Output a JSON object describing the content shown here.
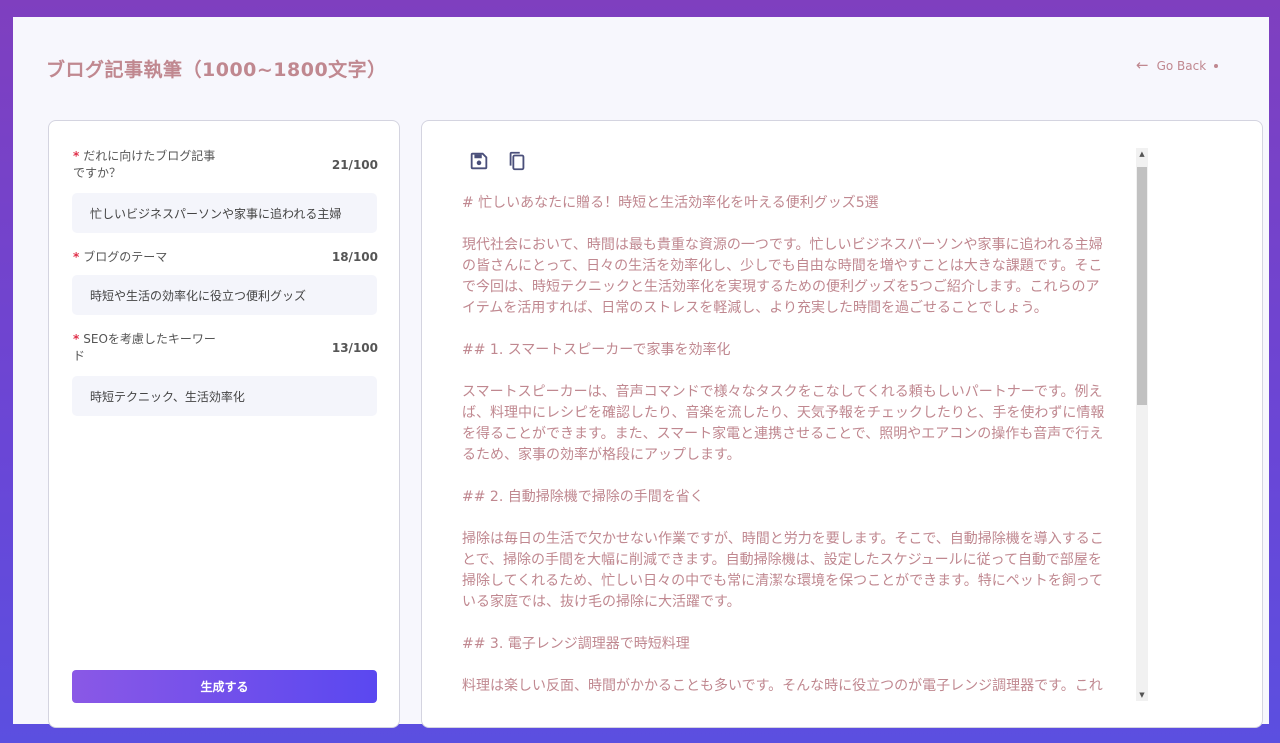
{
  "page": {
    "title": "ブログ記事執筆（1000~1800文字）",
    "go_back_label": "Go Back"
  },
  "form": {
    "fields": [
      {
        "label": "だれに向けたブログ記事ですか？",
        "required_mark": "*",
        "count": "21/100",
        "value": "忙しいビジネスパーソンや家事に追われる主婦"
      },
      {
        "label": "ブログのテーマ",
        "required_mark": "*",
        "count": "18/100",
        "value": "時短や生活の効率化に役立つ便利グッズ"
      },
      {
        "label": "SEOを考慮したキーワード",
        "required_mark": "*",
        "count": "13/100",
        "value": "時短テクニック、生活効率化"
      }
    ],
    "submit_label": "生成する"
  },
  "output": {
    "toolbar": {
      "save_icon": "save-icon",
      "copy_icon": "copy-icon"
    },
    "paragraphs": [
      "# 忙しいあなたに贈る！時短と生活効率化を叶える便利グッズ5選",
      "現代社会において、時間は最も貴重な資源の一つです。忙しいビジネスパーソンや家事に追われる主婦の皆さんにとって、日々の生活を効率化し、少しでも自由な時間を増やすことは大きな課題です。そこで今回は、時短テクニックと生活効率化を実現するための便利グッズを5つご紹介します。これらのアイテムを活用すれば、日常のストレスを軽減し、より充実した時間を過ごせることでしょう。",
      "## 1. スマートスピーカーで家事を効率化",
      "スマートスピーカーは、音声コマンドで様々なタスクをこなしてくれる頼もしいパートナーです。例えば、料理中にレシピを確認したり、音楽を流したり、天気予報をチェックしたりと、手を使わずに情報を得ることができます。また、スマート家電と連携させることで、照明やエアコンの操作も音声で行えるため、家事の効率が格段にアップします。",
      "## 2. 自動掃除機で掃除の手間を省く",
      "掃除は毎日の生活で欠かせない作業ですが、時間と労力を要します。そこで、自動掃除機を導入することで、掃除の手間を大幅に削減できます。自動掃除機は、設定したスケジュールに従って自動で部屋を掃除してくれるため、忙しい日々の中でも常に清潔な環境を保つことができます。特にペットを飼っている家庭では、抜け毛の掃除に大活躍です。",
      "## 3. 電子レンジ調理器で時短料理",
      "料理は楽しい反面、時間がかかることも多いです。そんな時に役立つのが電子レンジ調理器です。これ"
    ]
  },
  "colors": {
    "accent_text": "#c08890",
    "required": "#e0304a",
    "button_start": "#8a58e6",
    "button_end": "#5a48f0"
  }
}
